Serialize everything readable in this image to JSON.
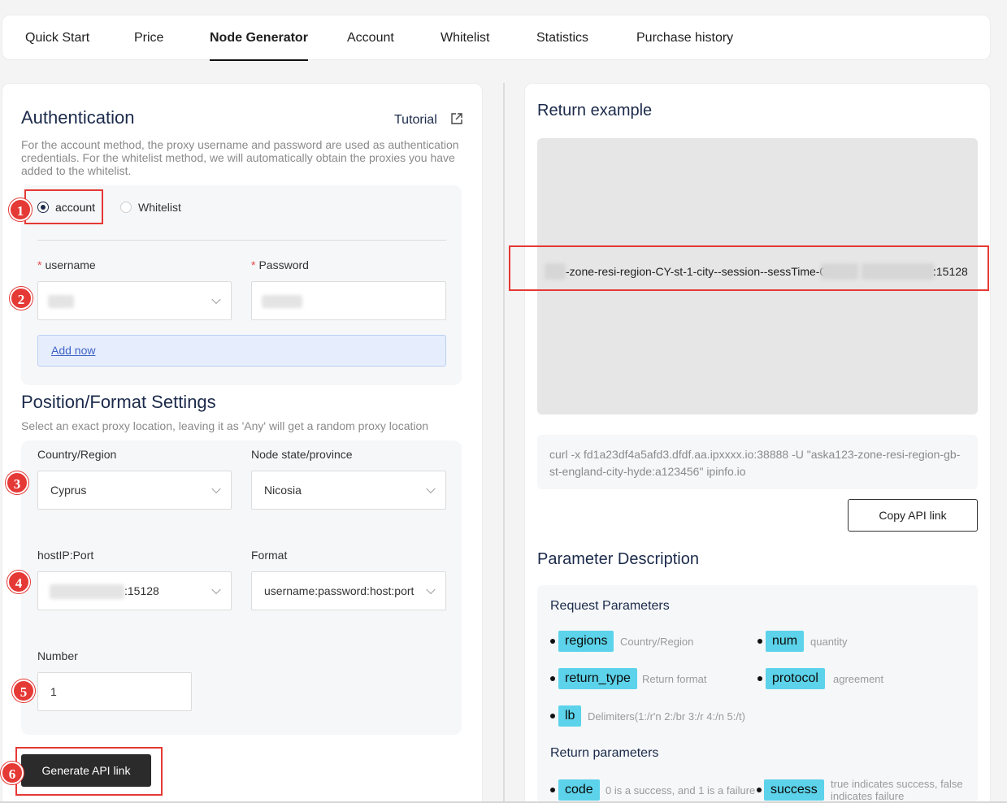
{
  "nav": {
    "tabs": [
      {
        "label": "Quick Start"
      },
      {
        "label": "Price"
      },
      {
        "label": "Node Generator"
      },
      {
        "label": "Account"
      },
      {
        "label": "Whitelist"
      },
      {
        "label": "Statistics"
      },
      {
        "label": "Purchase history"
      }
    ],
    "active_tab": "Node Generator"
  },
  "auth": {
    "title": "Authentication",
    "tutorial_label": "Tutorial",
    "tutorial_icon": "external-link-icon",
    "description": "For the account method, the proxy username and password are used as authentication credentials. For the whitelist method, we will automatically obtain the proxies you have added to the whitelist.",
    "methods": [
      {
        "label": "account",
        "selected": true
      },
      {
        "label": "Whitelist",
        "selected": false
      }
    ],
    "username_label": "username",
    "password_label": "Password",
    "required_mark": "*",
    "add_now_label": "Add now"
  },
  "position": {
    "title": "Position/Format Settings",
    "description": "Select an exact proxy location, leaving it as 'Any' will get a random proxy location",
    "country_label": "Country/Region",
    "country_value": "Cyprus",
    "state_label": "Node state/province",
    "state_value": "Nicosia",
    "host_label": "hostIP:Port",
    "host_value_suffix": ":15128",
    "format_label": "Format",
    "format_value": "username:password:host:port",
    "number_label": "Number",
    "number_value": "1",
    "generate_label": "Generate API link"
  },
  "annotations": [
    "1",
    "2",
    "3",
    "4",
    "5",
    "6"
  ],
  "return_example": {
    "title": "Return example",
    "line_mid": "-zone-resi-region-CY-st-1-city--session--sessTime-0:",
    "line_colon": "",
    "line_end": ":15128",
    "curl": "curl -x fd1a23df4a5afd3.dfdf.aa.ipxxxx.io:38888 -U \"aska123-zone-resi-region-gb-st-england-city-hyde:a123456\" ipinfo.io",
    "copy_label": "Copy API link"
  },
  "params": {
    "title": "Parameter Description",
    "request_title": "Request Parameters",
    "request": [
      {
        "name": "regions",
        "desc": "Country/Region"
      },
      {
        "name": "num",
        "desc": "quantity"
      },
      {
        "name": "return_type",
        "desc": "Return format"
      },
      {
        "name": "protocol",
        "desc": "agreement"
      },
      {
        "name": "lb",
        "desc": "Delimiters(1:/r'n 2:/br 3:/r 4:/n 5:/t)"
      }
    ],
    "return_title": "Return parameters",
    "returns": [
      {
        "name": "code",
        "desc": "0 is a success, and 1 is a failure"
      },
      {
        "name": "success",
        "desc": "true indicates success, false indicates failure"
      }
    ]
  },
  "colors": {
    "accent": "#5cd3ea",
    "annotation": "#e53935",
    "dark": "#2b2b2b"
  }
}
